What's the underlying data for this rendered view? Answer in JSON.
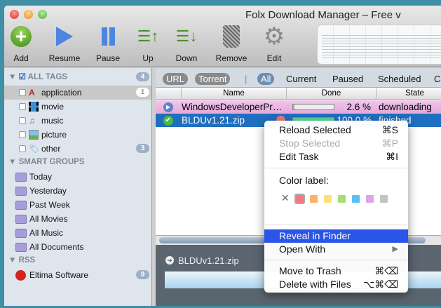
{
  "window": {
    "title": "Folx Download Manager – Free v"
  },
  "toolbar": {
    "items": [
      {
        "label": "Add"
      },
      {
        "label": "Resume"
      },
      {
        "label": "Pause"
      },
      {
        "label": "Up"
      },
      {
        "label": "Down"
      },
      {
        "label": "Remove"
      },
      {
        "label": "Edit"
      }
    ]
  },
  "sidebar": {
    "all_tags": {
      "label": "ALL TAGS",
      "count": "4"
    },
    "tags": [
      {
        "label": "application",
        "count": "1"
      },
      {
        "label": "movie"
      },
      {
        "label": "music"
      },
      {
        "label": "picture"
      },
      {
        "label": "other",
        "count": "3"
      }
    ],
    "smart_groups_label": "SMART GROUPS",
    "smart_groups": [
      "Today",
      "Yesterday",
      "Past Week",
      "All Movies",
      "All Music",
      "All Documents"
    ],
    "rss_label": "RSS",
    "rss": [
      {
        "label": "Eltima Software",
        "count": "9"
      }
    ]
  },
  "filters": {
    "url": "URL",
    "torrent": "Torrent",
    "all": "All",
    "current": "Current",
    "paused": "Paused",
    "scheduled": "Scheduled",
    "more": "C"
  },
  "table": {
    "columns": [
      "Name",
      "Done",
      "State"
    ],
    "rows": [
      {
        "name": "WindowsDeveloperPr…",
        "done": "2.6 %",
        "progress": 2.6,
        "state": "downloading"
      },
      {
        "name": "BLDUv1.21.zip",
        "done": "100.0 %",
        "progress": 100,
        "state": "finished"
      }
    ]
  },
  "detail": {
    "name": "BLDUv1.21.zip"
  },
  "context_menu": {
    "reload": {
      "label": "Reload Selected",
      "shortcut": "⌘S"
    },
    "stop": {
      "label": "Stop Selected",
      "shortcut": "⌘P"
    },
    "edit": {
      "label": "Edit Task",
      "shortcut": "⌘I"
    },
    "color_label": "Color label:",
    "colors": [
      "#f47a80",
      "#f9b26b",
      "#f8e27a",
      "#a9dc7d",
      "#5cc0f5",
      "#dda5e3",
      "#c4c4c4"
    ],
    "reveal": {
      "label": "Reveal in Finder"
    },
    "open_with": {
      "label": "Open With"
    },
    "trash": {
      "label": "Move to Trash",
      "shortcut": "⌘⌫"
    },
    "delete": {
      "label": "Delete with Files",
      "shortcut": "⌥⌘⌫"
    }
  }
}
